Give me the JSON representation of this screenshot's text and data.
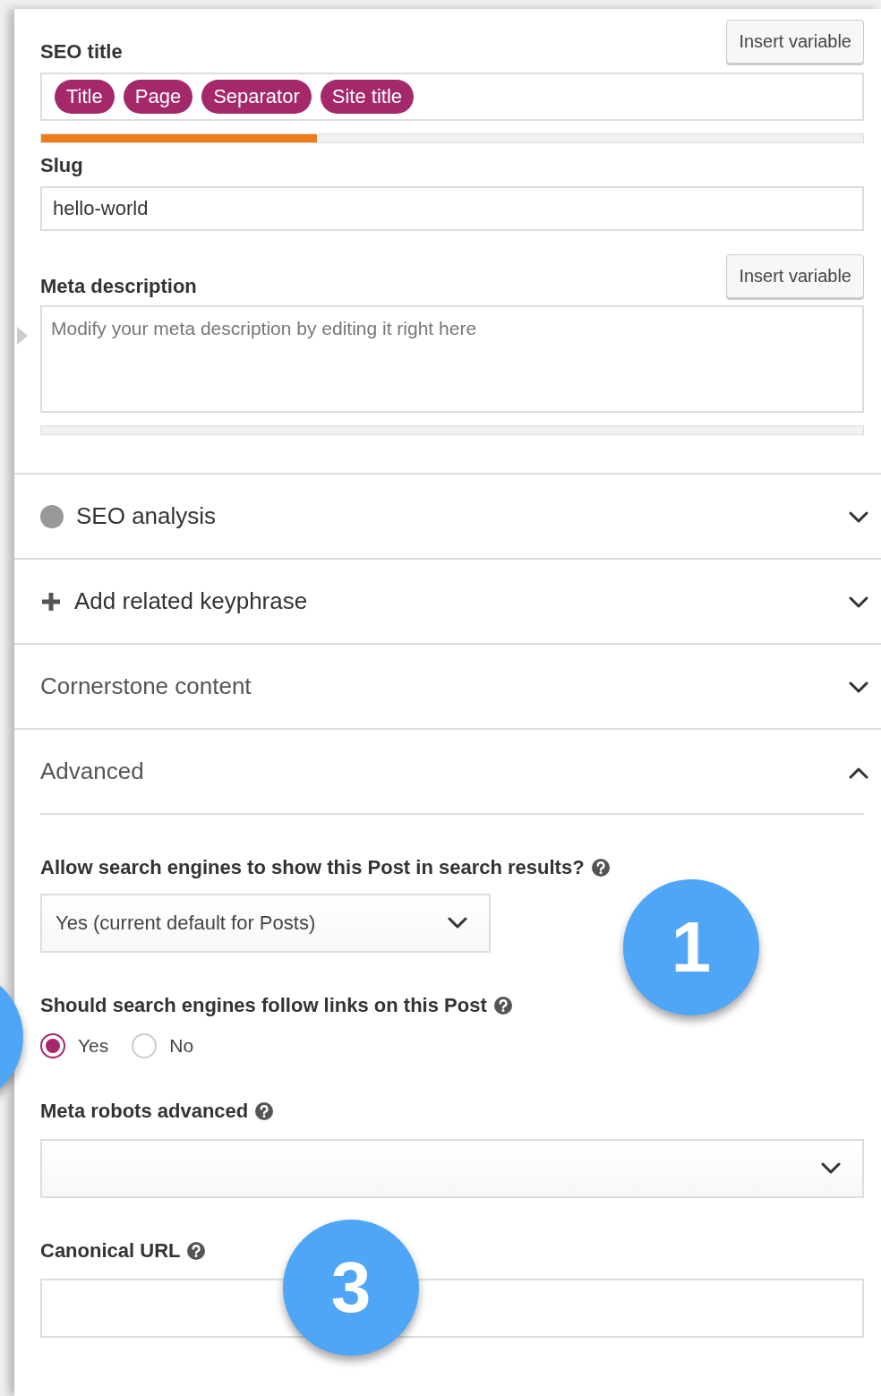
{
  "seo_title": {
    "label": "SEO title",
    "insert_button": "Insert variable",
    "tokens": [
      "Title",
      "Page",
      "Separator",
      "Site title"
    ],
    "level": 0.335
  },
  "slug": {
    "label": "Slug",
    "value": "hello-world"
  },
  "meta_description": {
    "label": "Meta description",
    "insert_button": "Insert variable",
    "placeholder": "Modify your meta description by editing it right here",
    "level": 0
  },
  "sections": [
    {
      "kind": "status",
      "title": "SEO analysis",
      "expanded": false
    },
    {
      "kind": "add",
      "title": "Add related keyphrase",
      "expanded": false
    },
    {
      "kind": "plain",
      "title": "Cornerstone content",
      "expanded": false
    },
    {
      "kind": "plain",
      "title": "Advanced",
      "expanded": true
    }
  ],
  "advanced": {
    "fields": [
      {
        "kind": "select",
        "label": "Allow search engines to show this Post in search results?",
        "value": "Yes (current default for Posts)"
      },
      {
        "kind": "radio",
        "label": "Should search engines follow links on this Post",
        "options": [
          {
            "label": "Yes",
            "selected": true
          },
          {
            "label": "No",
            "selected": false
          }
        ]
      },
      {
        "kind": "multiselect",
        "label": "Meta robots advanced"
      },
      {
        "kind": "text",
        "label": "Canonical URL"
      }
    ]
  },
  "callouts": [
    {
      "number": "1"
    },
    {
      "number": "3"
    }
  ]
}
